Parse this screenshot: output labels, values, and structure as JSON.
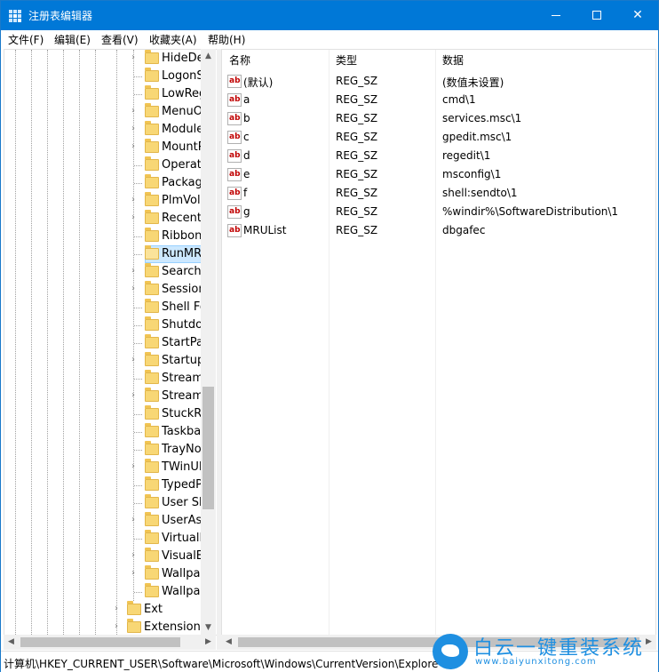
{
  "window": {
    "title": "注册表编辑器"
  },
  "menu": [
    "文件(F)",
    "编辑(E)",
    "查看(V)",
    "收藏夹(A)",
    "帮助(H)"
  ],
  "tree": {
    "items": [
      {
        "label": "HideDes",
        "expandable": true
      },
      {
        "label": "LogonSt",
        "expandable": false
      },
      {
        "label": "LowReg",
        "expandable": false
      },
      {
        "label": "MenuOr",
        "expandable": true
      },
      {
        "label": "Module",
        "expandable": true
      },
      {
        "label": "MountP",
        "expandable": true
      },
      {
        "label": "Operati",
        "expandable": false
      },
      {
        "label": "Package",
        "expandable": false
      },
      {
        "label": "PlmVola",
        "expandable": true
      },
      {
        "label": "RecentD",
        "expandable": true
      },
      {
        "label": "Ribbon",
        "expandable": false
      },
      {
        "label": "RunMRU",
        "expandable": false,
        "selected": true
      },
      {
        "label": "SearchP",
        "expandable": true
      },
      {
        "label": "Session",
        "expandable": true
      },
      {
        "label": "Shell Fo",
        "expandable": false
      },
      {
        "label": "Shutdov",
        "expandable": false
      },
      {
        "label": "StartPag",
        "expandable": false
      },
      {
        "label": "StartupA",
        "expandable": true
      },
      {
        "label": "StreamM",
        "expandable": false
      },
      {
        "label": "Streams",
        "expandable": true
      },
      {
        "label": "StuckRe",
        "expandable": false
      },
      {
        "label": "Taskbar",
        "expandable": false
      },
      {
        "label": "TrayNot",
        "expandable": false
      },
      {
        "label": "TWinUI",
        "expandable": true
      },
      {
        "label": "TypedPa",
        "expandable": false
      },
      {
        "label": "User Sh",
        "expandable": false
      },
      {
        "label": "UserAss",
        "expandable": true
      },
      {
        "label": "VirtualD",
        "expandable": false
      },
      {
        "label": "VisualEf",
        "expandable": true
      },
      {
        "label": "Wallpap",
        "expandable": true
      },
      {
        "label": "Wallpap",
        "expandable": false
      }
    ],
    "parent_items": [
      {
        "label": "Ext",
        "expandable": true
      },
      {
        "label": "Extensions",
        "expandable": true
      }
    ]
  },
  "list": {
    "columns": [
      "名称",
      "类型",
      "数据"
    ],
    "rows": [
      {
        "name": "(默认)",
        "type": "REG_SZ",
        "data": "(数值未设置)"
      },
      {
        "name": "a",
        "type": "REG_SZ",
        "data": "cmd\\1"
      },
      {
        "name": "b",
        "type": "REG_SZ",
        "data": "services.msc\\1"
      },
      {
        "name": "c",
        "type": "REG_SZ",
        "data": "gpedit.msc\\1"
      },
      {
        "name": "d",
        "type": "REG_SZ",
        "data": "regedit\\1"
      },
      {
        "name": "e",
        "type": "REG_SZ",
        "data": "msconfig\\1"
      },
      {
        "name": "f",
        "type": "REG_SZ",
        "data": "shell:sendto\\1"
      },
      {
        "name": "g",
        "type": "REG_SZ",
        "data": "%windir%\\SoftwareDistribution\\1"
      },
      {
        "name": "MRUList",
        "type": "REG_SZ",
        "data": "dbgafec"
      }
    ],
    "value_icon": "ab"
  },
  "status": {
    "path": "计算机\\HKEY_CURRENT_USER\\Software\\Microsoft\\Windows\\CurrentVersion\\Explore"
  },
  "watermark": {
    "main": "白云一键重装系统",
    "sub": "www.baiyunxitong.com"
  },
  "icons": {
    "tree_expander": "chevron-right-icon",
    "folder": "folder-icon",
    "string_value": "string-value-icon"
  },
  "colors": {
    "titlebar": "#0078d7",
    "selection": "#cce8ff",
    "folder": "#f8d775",
    "watermark": "#1e8fe1"
  }
}
